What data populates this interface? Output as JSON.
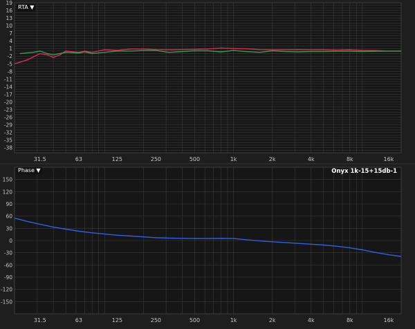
{
  "rta": {
    "menu_label": "RTA ▼",
    "y_ticks": [
      "19",
      "16",
      "13",
      "10",
      "7",
      "4",
      "1",
      "-2",
      "-5",
      "-8",
      "-11",
      "-14",
      "-17",
      "-20",
      "-23",
      "-26",
      "-29",
      "-32",
      "-35",
      "-38"
    ],
    "y_range": [
      -40,
      19
    ],
    "x_ticks": [
      "31.5",
      "63",
      "125",
      "250",
      "500",
      "1k",
      "2k",
      "4k",
      "8k",
      "16k"
    ],
    "x_range_hz": [
      20,
      20000
    ],
    "grid": true,
    "colors": {
      "background": "#1e1e1e",
      "grid": "#3a3a3a",
      "trace_red": "#e0285a",
      "trace_green": "#3aa04a"
    },
    "traces": [
      {
        "color_key": "trace_red",
        "points": [
          [
            20,
            -5
          ],
          [
            25,
            -3.5
          ],
          [
            31.5,
            -1
          ],
          [
            36,
            -1.5
          ],
          [
            40,
            -2.5
          ],
          [
            45,
            -1.5
          ],
          [
            50,
            0
          ],
          [
            63,
            -0.5
          ],
          [
            70,
            0
          ],
          [
            80,
            -0.5
          ],
          [
            100,
            0.5
          ],
          [
            125,
            0.3
          ],
          [
            160,
            0.8
          ],
          [
            200,
            0.8
          ],
          [
            250,
            0.6
          ],
          [
            315,
            0.5
          ],
          [
            400,
            0.6
          ],
          [
            500,
            0.7
          ],
          [
            630,
            0.8
          ],
          [
            800,
            1.2
          ],
          [
            1000,
            1.0
          ],
          [
            1250,
            0.9
          ],
          [
            1600,
            0.6
          ],
          [
            2000,
            0.5
          ],
          [
            2500,
            0.5
          ],
          [
            3150,
            0.6
          ],
          [
            4000,
            0.5
          ],
          [
            5000,
            0.5
          ],
          [
            6300,
            0.4
          ],
          [
            8000,
            0.5
          ],
          [
            10000,
            0.3
          ],
          [
            12500,
            0.2
          ],
          [
            16000,
            0.0
          ],
          [
            20000,
            0.0
          ]
        ]
      },
      {
        "color_key": "trace_green",
        "points": [
          [
            22,
            -1
          ],
          [
            28,
            -0.5
          ],
          [
            31.5,
            0
          ],
          [
            36,
            -1
          ],
          [
            40,
            -1.5
          ],
          [
            50,
            -0.5
          ],
          [
            63,
            -0.8
          ],
          [
            70,
            -0.3
          ],
          [
            80,
            -1
          ],
          [
            100,
            -0.5
          ],
          [
            125,
            0
          ],
          [
            160,
            0
          ],
          [
            200,
            0.2
          ],
          [
            250,
            0.2
          ],
          [
            315,
            -0.5
          ],
          [
            400,
            -0.2
          ],
          [
            500,
            0.1
          ],
          [
            630,
            0.1
          ],
          [
            800,
            -0.3
          ],
          [
            1000,
            0.2
          ],
          [
            1250,
            -0.2
          ],
          [
            1600,
            -0.5
          ],
          [
            2000,
            0.1
          ],
          [
            2500,
            -0.2
          ],
          [
            3150,
            -0.3
          ],
          [
            4000,
            -0.2
          ],
          [
            5000,
            -0.2
          ],
          [
            6300,
            -0.1
          ],
          [
            8000,
            -0.1
          ],
          [
            10000,
            -0.2
          ],
          [
            12500,
            -0.1
          ],
          [
            16000,
            0
          ],
          [
            20000,
            0
          ]
        ]
      }
    ]
  },
  "phase": {
    "menu_label": "Phase ▼",
    "trace_name": "Onyx 1k-15+15db-1",
    "y_ticks": [
      "150",
      "120",
      "90",
      "60",
      "30",
      "0",
      "-30",
      "-60",
      "-90",
      "-120",
      "-150"
    ],
    "y_range": [
      -180,
      180
    ],
    "x_ticks": [
      "31.5",
      "63",
      "125",
      "250",
      "500",
      "1k",
      "2k",
      "4k",
      "8k",
      "16k"
    ],
    "x_range_hz": [
      20,
      20000
    ],
    "grid": true,
    "colors": {
      "background": "#1e1e1e",
      "grid": "#3a3a3a",
      "trace": "#3060e8"
    },
    "points": [
      [
        20,
        55
      ],
      [
        25,
        47
      ],
      [
        31.5,
        40
      ],
      [
        40,
        33
      ],
      [
        50,
        28
      ],
      [
        63,
        23
      ],
      [
        80,
        19
      ],
      [
        100,
        16
      ],
      [
        125,
        13
      ],
      [
        160,
        11
      ],
      [
        200,
        9
      ],
      [
        250,
        7
      ],
      [
        315,
        6
      ],
      [
        400,
        5.5
      ],
      [
        500,
        5
      ],
      [
        630,
        5
      ],
      [
        800,
        5.5
      ],
      [
        1000,
        5
      ],
      [
        1250,
        2
      ],
      [
        1600,
        -1
      ],
      [
        2000,
        -3
      ],
      [
        2500,
        -5
      ],
      [
        3150,
        -7
      ],
      [
        4000,
        -9
      ],
      [
        5000,
        -11
      ],
      [
        6300,
        -14
      ],
      [
        8000,
        -18
      ],
      [
        10000,
        -23
      ],
      [
        12500,
        -29
      ],
      [
        16000,
        -35
      ],
      [
        20000,
        -39
      ]
    ]
  }
}
